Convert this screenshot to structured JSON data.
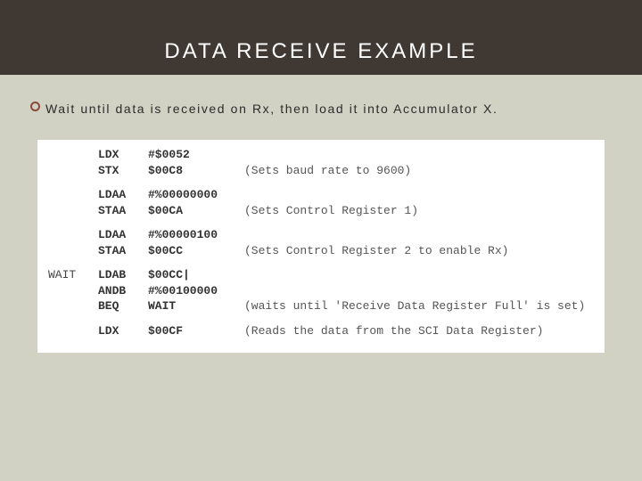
{
  "header": {
    "title": "DATA RECEIVE EXAMPLE"
  },
  "bullet": {
    "text": "Wait until data is received on Rx, then load it into Accumulator X."
  },
  "code": {
    "groups": [
      [
        {
          "label": "",
          "mnemonic": "LDX",
          "operand": "#$0052",
          "comment": ""
        },
        {
          "label": "",
          "mnemonic": "STX",
          "operand": "$00C8",
          "comment": "(Sets baud rate to 9600)"
        }
      ],
      [
        {
          "label": "",
          "mnemonic": "LDAA",
          "operand": "#%00000000",
          "comment": ""
        },
        {
          "label": "",
          "mnemonic": "STAA",
          "operand": "$00CA",
          "comment": "(Sets Control Register 1)"
        }
      ],
      [
        {
          "label": "",
          "mnemonic": "LDAA",
          "operand": "#%00000100",
          "comment": ""
        },
        {
          "label": "",
          "mnemonic": "STAA",
          "operand": "$00CC",
          "comment": "(Sets Control Register 2 to enable Rx)"
        }
      ],
      [
        {
          "label": "WAIT",
          "mnemonic": "LDAB",
          "operand": "$00CC|",
          "comment": ""
        },
        {
          "label": "",
          "mnemonic": "ANDB",
          "operand": "#%00100000",
          "comment": ""
        },
        {
          "label": "",
          "mnemonic": "BEQ",
          "operand": "WAIT",
          "comment": "(waits until 'Receive Data Register Full' is set)"
        }
      ],
      [
        {
          "label": "",
          "mnemonic": "LDX",
          "operand": "$00CF",
          "comment": "(Reads the data from the SCI Data Register)"
        }
      ]
    ]
  }
}
